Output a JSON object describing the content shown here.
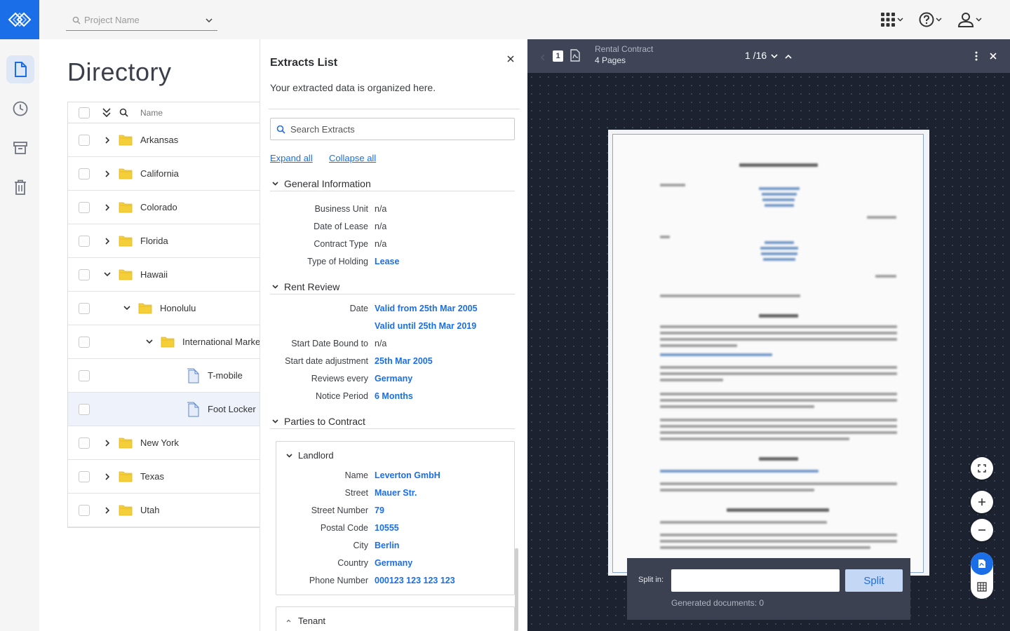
{
  "colors": {
    "accent": "#1a6fe8",
    "viewer_bg": "#1d2230",
    "viewer_bar": "#3f4556"
  },
  "header": {
    "project_placeholder": "Project Name",
    "icons": [
      "apps-grid-icon",
      "help-icon",
      "user-icon"
    ]
  },
  "nav": {
    "items": [
      "documents-icon",
      "history-icon",
      "archive-icon",
      "trash-icon"
    ]
  },
  "directory": {
    "title": "Directory",
    "column_name": "Name",
    "rows": [
      {
        "label": "Arkansas",
        "type": "folder",
        "level": 0,
        "expanded": false
      },
      {
        "label": "California",
        "type": "folder",
        "level": 0,
        "expanded": false
      },
      {
        "label": "Colorado",
        "type": "folder",
        "level": 0,
        "expanded": false
      },
      {
        "label": "Florida",
        "type": "folder",
        "level": 0,
        "expanded": false
      },
      {
        "label": "Hawaii",
        "type": "folder",
        "level": 0,
        "expanded": true
      },
      {
        "label": "Honolulu",
        "type": "folder",
        "level": 1,
        "expanded": true
      },
      {
        "label": "International Marke",
        "type": "folder",
        "level": 2,
        "expanded": true
      },
      {
        "label": "T-mobile",
        "type": "file",
        "level": 3
      },
      {
        "label": "Foot Locker",
        "type": "file",
        "level": 3,
        "selected": true
      },
      {
        "label": "New York",
        "type": "folder",
        "level": 0,
        "expanded": false
      },
      {
        "label": "Texas",
        "type": "folder",
        "level": 0,
        "expanded": false
      },
      {
        "label": "Utah",
        "type": "folder",
        "level": 0,
        "expanded": false
      }
    ]
  },
  "extracts": {
    "title": "Extracts List",
    "subtitle": "Your extracted data is organized here.",
    "search_placeholder": "Search Extracts",
    "expand_all": "Expand all",
    "collapse_all": "Collapse all",
    "general": {
      "title": "General Information",
      "fields": [
        {
          "key": "Business Unit",
          "value": "n/a",
          "link": false
        },
        {
          "key": "Date of Lease",
          "value": "n/a",
          "link": false
        },
        {
          "key": "Contract Type",
          "value": "n/a",
          "link": false
        },
        {
          "key": "Type of Holding",
          "value": "Lease",
          "link": true
        }
      ]
    },
    "rent": {
      "title": "Rent Review",
      "fields": [
        {
          "key": "Date",
          "value": "Valid from 25th Mar 2005",
          "link": true
        },
        {
          "key": "",
          "value": "Valid until 25th Mar 2019",
          "link": true
        },
        {
          "key": "Start Date Bound to",
          "value": "n/a",
          "link": false
        },
        {
          "key": "Start  date adjustment",
          "value": "25th Mar 2005",
          "link": true
        },
        {
          "key": "Reviews every",
          "value": "Germany",
          "link": true
        },
        {
          "key": "Notice Period",
          "value": "6 Months",
          "link": true
        }
      ]
    },
    "parties": {
      "title": "Parties to Contract",
      "landlord": {
        "title": "Landlord",
        "fields": [
          {
            "key": "Name",
            "value": "Leverton GmbH"
          },
          {
            "key": "Street",
            "value": "Mauer Str."
          },
          {
            "key": "Street Number",
            "value": "79"
          },
          {
            "key": "Postal Code",
            "value": "10555"
          },
          {
            "key": "City",
            "value": "Berlin"
          },
          {
            "key": "Country",
            "value": "Germany"
          },
          {
            "key": "Phone Number",
            "value": "000123 123 123 123"
          }
        ]
      },
      "tenant": {
        "title": "Tenant"
      }
    }
  },
  "viewer": {
    "page_badge": "1",
    "doc_title": "Rental Contract",
    "doc_pages": "4 Pages",
    "page_indicator": "1 /16",
    "split_label": "Split in:",
    "split_value": "",
    "split_button": "Split",
    "generated": "Generated documents: 0"
  }
}
